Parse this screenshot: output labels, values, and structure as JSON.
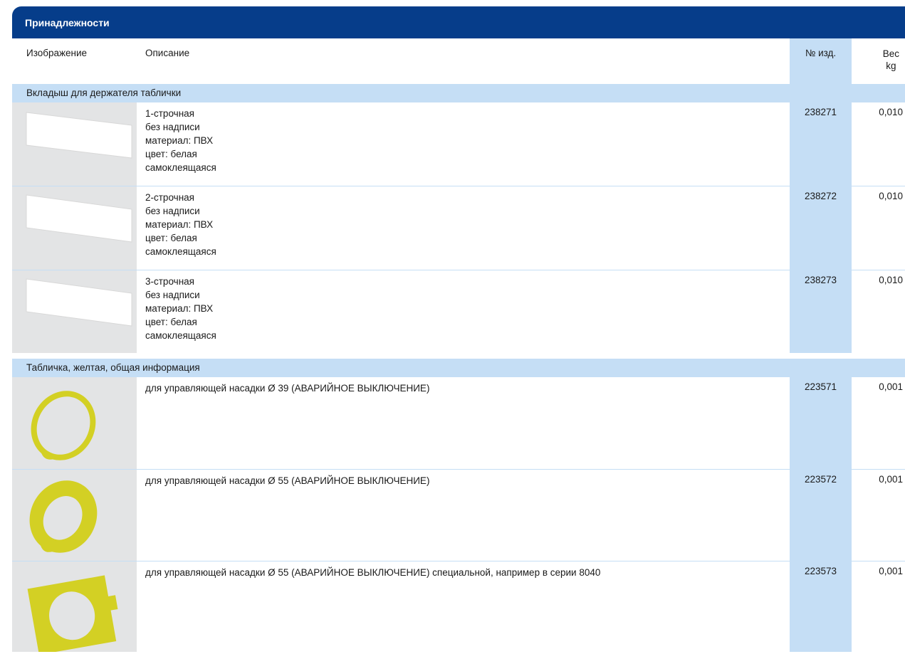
{
  "title": "Принадлежности",
  "columns": {
    "image": "Изображение",
    "description": "Описание",
    "part_no": "№ изд.",
    "weight_line1": "Вес",
    "weight_line2": "kg"
  },
  "sections": [
    {
      "title": "Вкладыш для держателя таблички",
      "rows": [
        {
          "image": "white-label-insert",
          "lines": [
            "1-строчная",
            "без надписи",
            "материал: ПВХ",
            "цвет: белая",
            "самоклеящаяся"
          ],
          "part_no": "238271",
          "weight": "0,010"
        },
        {
          "image": "white-label-insert",
          "lines": [
            "2-строчная",
            "без надписи",
            "материал: ПВХ",
            "цвет: белая",
            "самоклеящаяся"
          ],
          "part_no": "238272",
          "weight": "0,010"
        },
        {
          "image": "white-label-insert",
          "lines": [
            "3-строчная",
            "без надписи",
            "материал: ПВХ",
            "цвет: белая",
            "самоклеящаяся"
          ],
          "part_no": "238273",
          "weight": "0,010"
        }
      ]
    },
    {
      "title": "Табличка, желтая, общая информация",
      "rows": [
        {
          "image": "yellow-ring-thin",
          "lines": [
            "для управляющей насадки Ø 39 (АВАРИЙНОЕ ВЫКЛЮЧЕНИЕ)"
          ],
          "part_no": "223571",
          "weight": "0,001"
        },
        {
          "image": "yellow-ring-wide",
          "lines": [
            "для управляющей насадки Ø 55 (АВАРИЙНОЕ ВЫКЛЮЧЕНИЕ)"
          ],
          "part_no": "223572",
          "weight": "0,001"
        },
        {
          "image": "yellow-rect-plate",
          "lines": [
            "для управляющей насадки Ø 55 (АВАРИЙНОЕ ВЫКЛЮЧЕНИЕ) специальной, например в серии 8040"
          ],
          "part_no": "223573",
          "weight": "0,001"
        }
      ]
    }
  ],
  "colors": {
    "header_bar": "#063d8a",
    "light_blue": "#c5def5",
    "image_bg": "#e3e4e5",
    "yellow": "#d3d024"
  }
}
